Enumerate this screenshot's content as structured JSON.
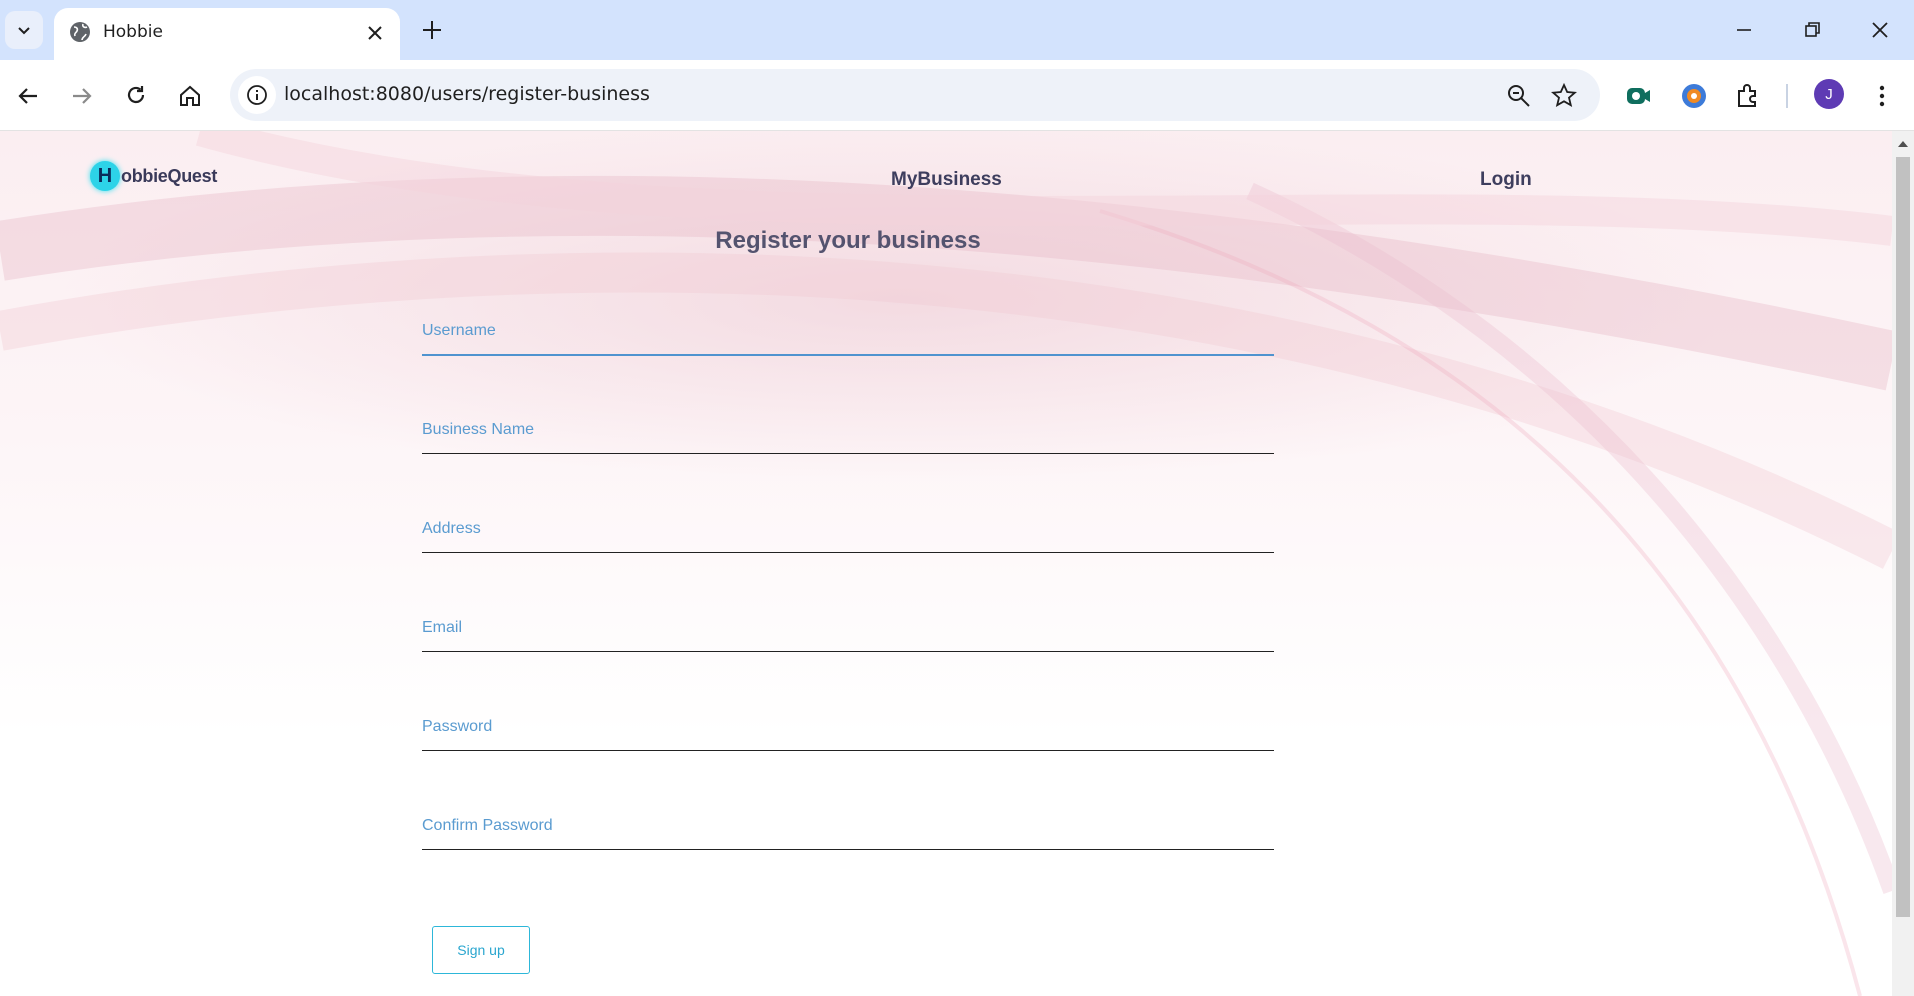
{
  "browser": {
    "tab_title": "Hobbie",
    "url": "localhost:8080/users/register-business",
    "profile_initial": "J"
  },
  "header": {
    "logo_letter": "H",
    "logo_text": "obbieQuest",
    "nav": [
      "MyBusiness",
      "Login"
    ]
  },
  "form": {
    "title": "Register your business",
    "fields": [
      {
        "label": "Username"
      },
      {
        "label": "Business Name"
      },
      {
        "label": "Address"
      },
      {
        "label": "Email"
      },
      {
        "label": "Password"
      },
      {
        "label": "Confirm Password"
      }
    ],
    "submit_label": "Sign up"
  },
  "colors": {
    "chrome_tabstrip": "#d3e3fd",
    "field_label": "#5a9bd0",
    "active_underline": "#4f93cf",
    "button_border": "#2db7d9",
    "logo_badge": "#2dd3e8"
  }
}
